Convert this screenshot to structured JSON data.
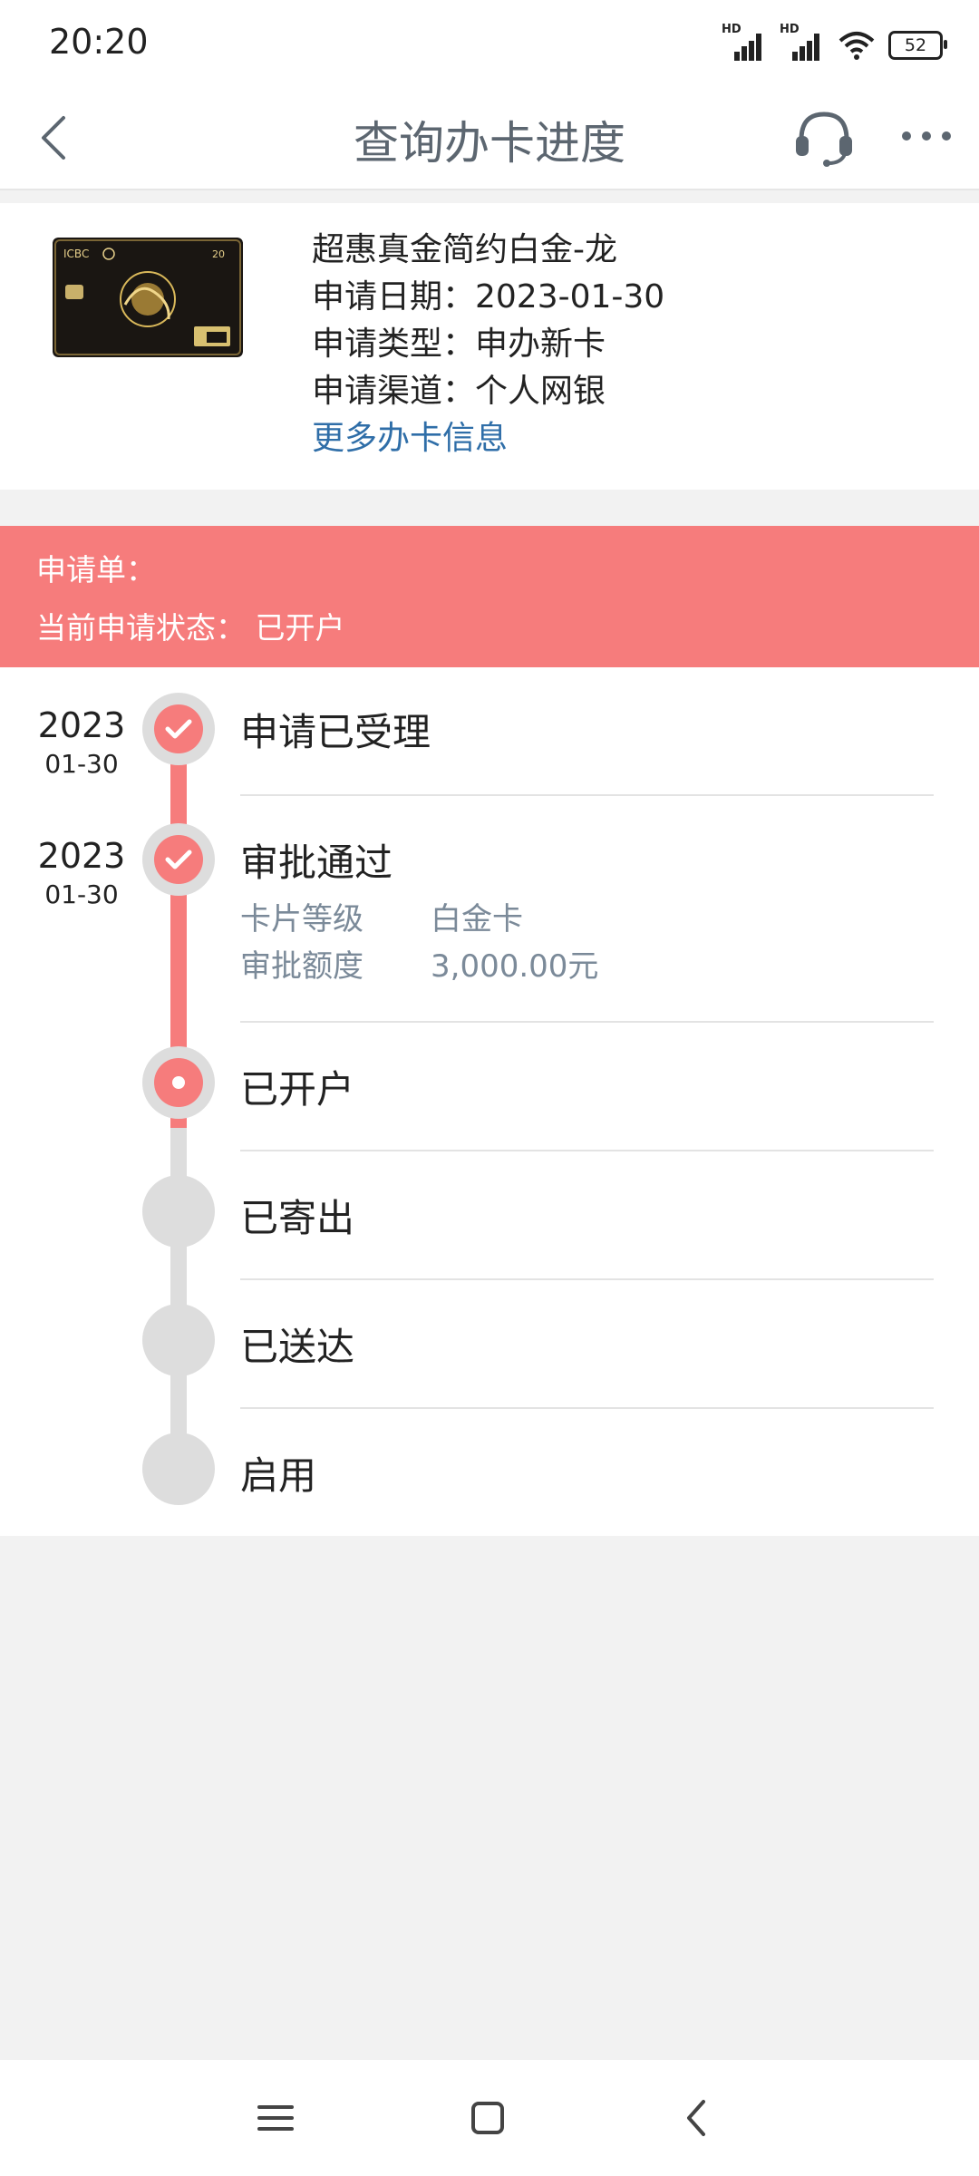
{
  "status_bar": {
    "time": "20:20",
    "signal_1_label": "HD",
    "signal_2_label": "HD",
    "battery": "52"
  },
  "nav": {
    "title": "查询办卡进度",
    "back_icon": "chevron-left-icon",
    "support_icon": "headset-icon",
    "more_icon": "more-horizontal-icon"
  },
  "card": {
    "name": "超惠真金简约白金-龙",
    "apply_date": "申请日期：2023-01-30",
    "apply_type": "申请类型：申办新卡",
    "apply_channel": "申请渠道：个人网银",
    "more_info_link": "更多办卡信息",
    "image_brand": "ICBC"
  },
  "application": {
    "number_label": "申请单：",
    "status_label": "当前申请状态：",
    "status_value": "已开户"
  },
  "timeline": {
    "steps": [
      {
        "title": "申请已受理",
        "year": "2023",
        "date": "01-30",
        "state": "done"
      },
      {
        "title": "审批通过",
        "year": "2023",
        "date": "01-30",
        "state": "done",
        "details": [
          {
            "label": "卡片等级",
            "value": "白金卡"
          },
          {
            "label": "审批额度",
            "value": "3,000.00元"
          }
        ]
      },
      {
        "title": "已开户",
        "state": "current"
      },
      {
        "title": "已寄出",
        "state": "pending"
      },
      {
        "title": "已送达",
        "state": "pending"
      },
      {
        "title": "启用",
        "state": "pending"
      }
    ]
  },
  "colors": {
    "accent": "#f67c7c",
    "link": "#2f6ea8",
    "muted": "#7b8a99",
    "title": "#5c6670"
  },
  "system_nav": {
    "menu_icon": "menu-icon",
    "home_icon": "home-square-icon",
    "back_icon": "back-chevron-icon"
  }
}
